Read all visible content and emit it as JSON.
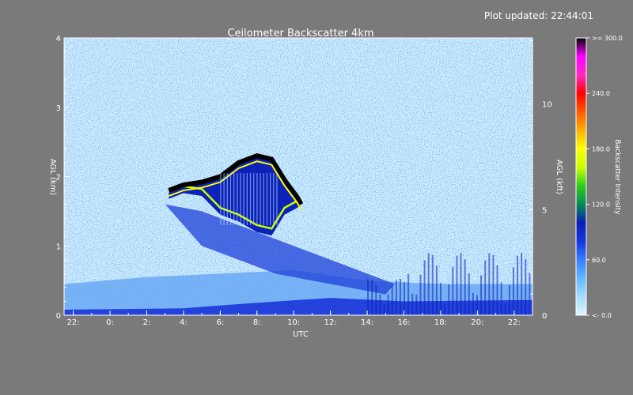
{
  "header": {
    "updated_label": "Plot updated: 22:44:01"
  },
  "colors": {
    "background": "#7a7a7a",
    "axis": "#ffffff",
    "low": "#cfefff",
    "mid": "#3a74e8",
    "dense": "#0a22c8",
    "ramp": [
      "#dff4ff",
      "#a6dcff",
      "#66b8ff",
      "#3a7cff",
      "#1436e0",
      "#0a1fb0",
      "#0a8a55",
      "#2ecc20",
      "#c8ff00",
      "#ffff00",
      "#ffb000",
      "#ff5a00",
      "#ff0000",
      "#ff2cc0",
      "#ff00ff",
      "#000000"
    ]
  },
  "chart_data": {
    "type": "heatmap",
    "title": "Ceilometer Backscatter 4km",
    "xlabel": "UTC",
    "ylabel": "AGL (km)",
    "y2label": "AGL (kft)",
    "x_ticks": [
      "22:",
      "0:",
      "2:",
      "4:",
      "6:",
      "8:",
      "10:",
      "12:",
      "14:",
      "16:",
      "18:",
      "20:",
      "22:"
    ],
    "x_tick_hours": [
      -2,
      0,
      2,
      4,
      6,
      8,
      10,
      12,
      14,
      16,
      18,
      20,
      22
    ],
    "xlim": [
      -2.5,
      23
    ],
    "ylim": [
      0,
      4
    ],
    "y_ticks": [
      "0",
      "1",
      "2",
      "3",
      "4"
    ],
    "y2_ticks": [
      "0",
      "5",
      "10"
    ],
    "y2_tick_km": [
      0,
      1.524,
      3.048
    ],
    "colorbar": {
      "label": "Backscatter Intensity",
      "ticks": [
        "<- 0.0",
        "60.0",
        "120.0",
        "180.0",
        "240.0",
        ">= 300.0"
      ],
      "tick_values": [
        0,
        60,
        120,
        180,
        240,
        300
      ],
      "range": [
        0,
        300
      ]
    },
    "features": {
      "cloud_top_km": [
        [
          3.2,
          1.8
        ],
        [
          4.0,
          1.88
        ],
        [
          5.0,
          1.92
        ],
        [
          6.0,
          2.0
        ],
        [
          7.0,
          2.2
        ],
        [
          8.0,
          2.3
        ],
        [
          8.8,
          2.25
        ],
        [
          9.5,
          1.95
        ],
        [
          10.2,
          1.7
        ],
        [
          10.4,
          1.6
        ]
      ],
      "cloud_base_km": [
        [
          3.2,
          1.68
        ],
        [
          4.0,
          1.76
        ],
        [
          5.0,
          1.72
        ],
        [
          6.0,
          1.45
        ],
        [
          7.0,
          1.35
        ],
        [
          8.0,
          1.2
        ],
        [
          8.8,
          1.15
        ],
        [
          9.5,
          1.45
        ],
        [
          10.2,
          1.55
        ]
      ],
      "boundary_layer_top_km": [
        [
          -2.5,
          0.45
        ],
        [
          2,
          0.55
        ],
        [
          6,
          0.6
        ],
        [
          10,
          0.65
        ],
        [
          14,
          0.5
        ],
        [
          18,
          0.45
        ],
        [
          23,
          0.45
        ]
      ]
    }
  }
}
